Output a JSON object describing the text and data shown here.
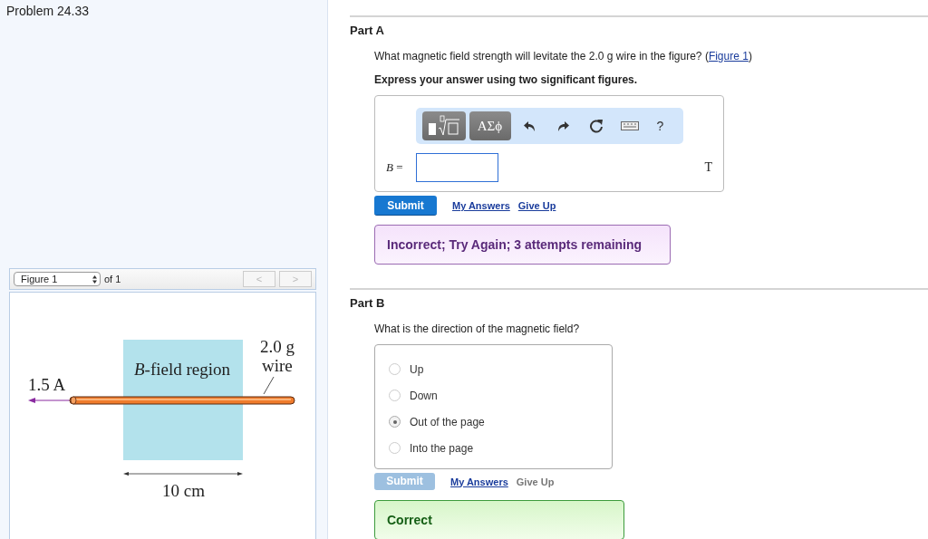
{
  "problem_title": "Problem 24.33",
  "figure_viewer": {
    "select": "Figure 1",
    "count": "of 1",
    "prev": {
      "label": "<",
      "disabled": true
    },
    "next": {
      "label": ">",
      "disabled": true
    }
  },
  "figure": {
    "current_label": "1.5 A",
    "field_label": "*B*-field region",
    "mass_label": "2.0 g",
    "wire_label": "wire",
    "width_label": "10 cm"
  },
  "parts": [
    {
      "title": "Part A",
      "kind": "numeric",
      "question": "What magnetic field strength will levitate the 2.0 g wire in the figure?",
      "link_open": "(",
      "figure_link": "Figure 1",
      "link_close": ")",
      "instruction": "Express your answer using two significant figures.",
      "greek_button": "ΑΣϕ",
      "help_button": "?",
      "answer_label": "*B* =",
      "unit": "T",
      "submit": {
        "label": "Submit",
        "disabled": false
      },
      "links": [
        {
          "label": "My Answers",
          "disabled": false
        },
        {
          "label": "Give Up",
          "disabled": false
        }
      ],
      "feedback": {
        "kind": "incorrect",
        "text": "Incorrect; Try Again; 3 attempts remaining"
      }
    },
    {
      "title": "Part B",
      "kind": "choice",
      "question": "What is the direction of the magnetic field?",
      "options": [
        {
          "label": "Up",
          "selected": false
        },
        {
          "label": "Down",
          "selected": false
        },
        {
          "label": "Out of the page",
          "selected": true
        },
        {
          "label": "Into the page",
          "selected": false
        }
      ],
      "submit": {
        "label": "Submit",
        "disabled": true
      },
      "links": [
        {
          "label": "My Answers",
          "disabled": false
        },
        {
          "label": "Give Up",
          "disabled": true
        }
      ],
      "feedback": {
        "kind": "correct",
        "text": "Correct"
      }
    }
  ]
}
